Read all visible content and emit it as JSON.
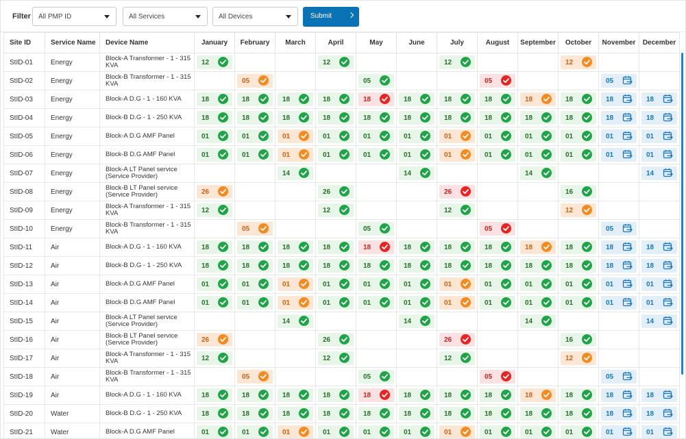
{
  "filter": {
    "label": "Filter",
    "pmp": "All PMP ID",
    "services": "All Services",
    "devices": "All Devices",
    "submit": "Submit"
  },
  "columns": {
    "site_id": "Site ID",
    "service": "Service Name",
    "device": "Device Name",
    "months": [
      "January",
      "February",
      "March",
      "April",
      "May",
      "June",
      "July",
      "August",
      "September",
      "October",
      "November",
      "December"
    ]
  },
  "status_icons": {
    "ok": "check-circle-icon",
    "warn": "check-circle-icon",
    "err": "check-circle-icon",
    "sched": "calendar-icon"
  },
  "colors": {
    "ok": "#21a34a",
    "warn": "#f28b22",
    "err": "#e52525",
    "sched": "#1b75bb",
    "accent": "#0a73b5"
  },
  "rows": [
    {
      "site": "StID-01",
      "service": "Energy",
      "device": "Block-A Transformer - 1 - 315 KVA",
      "cells": [
        {
          "v": "12",
          "s": "ok"
        },
        null,
        null,
        {
          "v": "12",
          "s": "ok"
        },
        null,
        null,
        {
          "v": "12",
          "s": "ok"
        },
        null,
        null,
        {
          "v": "12",
          "s": "warn"
        },
        null,
        null
      ]
    },
    {
      "site": "StID-02",
      "service": "Energy",
      "device": "Block-B Transformer - 1 - 315 KVA",
      "cells": [
        null,
        {
          "v": "05",
          "s": "warn"
        },
        null,
        null,
        {
          "v": "05",
          "s": "ok"
        },
        null,
        null,
        {
          "v": "05",
          "s": "err"
        },
        null,
        null,
        {
          "v": "05",
          "s": "sched"
        },
        null
      ]
    },
    {
      "site": "StID-03",
      "service": "Energy",
      "device": "Block-A D.G - 1 - 160 KVA",
      "cells": [
        {
          "v": "18",
          "s": "ok"
        },
        {
          "v": "18",
          "s": "ok"
        },
        {
          "v": "18",
          "s": "ok"
        },
        {
          "v": "18",
          "s": "ok"
        },
        {
          "v": "18",
          "s": "err"
        },
        {
          "v": "18",
          "s": "ok"
        },
        {
          "v": "18",
          "s": "ok"
        },
        {
          "v": "18",
          "s": "ok"
        },
        {
          "v": "18",
          "s": "warn"
        },
        {
          "v": "18",
          "s": "ok"
        },
        {
          "v": "18",
          "s": "sched"
        },
        {
          "v": "18",
          "s": "sched"
        }
      ]
    },
    {
      "site": "StID-04",
      "service": "Energy",
      "device": "Block-B D.G - 1 - 250 KVA",
      "cells": [
        {
          "v": "18",
          "s": "ok"
        },
        {
          "v": "18",
          "s": "ok"
        },
        {
          "v": "18",
          "s": "ok"
        },
        {
          "v": "18",
          "s": "ok"
        },
        {
          "v": "18",
          "s": "ok"
        },
        {
          "v": "18",
          "s": "ok"
        },
        {
          "v": "18",
          "s": "ok"
        },
        {
          "v": "18",
          "s": "ok"
        },
        {
          "v": "18",
          "s": "ok"
        },
        {
          "v": "18",
          "s": "ok"
        },
        {
          "v": "18",
          "s": "sched"
        },
        {
          "v": "18",
          "s": "sched"
        }
      ]
    },
    {
      "site": "StID-05",
      "service": "Energy",
      "device": "Block-A D.G AMF Panel",
      "cells": [
        {
          "v": "01",
          "s": "ok"
        },
        {
          "v": "01",
          "s": "ok"
        },
        {
          "v": "01",
          "s": "warn"
        },
        {
          "v": "01",
          "s": "ok"
        },
        {
          "v": "01",
          "s": "ok"
        },
        {
          "v": "01",
          "s": "ok"
        },
        {
          "v": "01",
          "s": "warn"
        },
        {
          "v": "01",
          "s": "ok"
        },
        {
          "v": "01",
          "s": "ok"
        },
        {
          "v": "01",
          "s": "ok"
        },
        {
          "v": "01",
          "s": "sched"
        },
        {
          "v": "01",
          "s": "sched"
        }
      ]
    },
    {
      "site": "StID-06",
      "service": "Energy",
      "device": "Block-B D.G AMF Panel",
      "cells": [
        {
          "v": "01",
          "s": "ok"
        },
        {
          "v": "01",
          "s": "ok"
        },
        {
          "v": "01",
          "s": "warn"
        },
        {
          "v": "01",
          "s": "ok"
        },
        {
          "v": "01",
          "s": "ok"
        },
        {
          "v": "01",
          "s": "ok"
        },
        {
          "v": "01",
          "s": "warn"
        },
        {
          "v": "01",
          "s": "ok"
        },
        {
          "v": "01",
          "s": "ok"
        },
        {
          "v": "01",
          "s": "ok"
        },
        {
          "v": "01",
          "s": "sched"
        },
        {
          "v": "01",
          "s": "sched"
        }
      ]
    },
    {
      "site": "StID-07",
      "service": "Energy",
      "device": "Block-A LT Panel service (Service Provider)",
      "cells": [
        null,
        null,
        {
          "v": "14",
          "s": "ok"
        },
        null,
        null,
        {
          "v": "14",
          "s": "ok"
        },
        null,
        null,
        {
          "v": "14",
          "s": "ok"
        },
        null,
        null,
        {
          "v": "14",
          "s": "sched"
        }
      ]
    },
    {
      "site": "StID-08",
      "service": "Energy",
      "device": "Block-B LT Panel service (Service Provider)",
      "cells": [
        {
          "v": "26",
          "s": "warn"
        },
        null,
        null,
        {
          "v": "26",
          "s": "ok"
        },
        null,
        null,
        {
          "v": "26",
          "s": "err"
        },
        null,
        null,
        {
          "v": "16",
          "s": "ok"
        },
        null,
        null
      ]
    },
    {
      "site": "StID-09",
      "service": "Energy",
      "device": "Block-A Transformer - 1 - 315 KVA",
      "cells": [
        {
          "v": "12",
          "s": "ok"
        },
        null,
        null,
        {
          "v": "12",
          "s": "ok"
        },
        null,
        null,
        {
          "v": "12",
          "s": "ok"
        },
        null,
        null,
        {
          "v": "12",
          "s": "warn"
        },
        null,
        null
      ]
    },
    {
      "site": "StID-10",
      "service": "Energy",
      "device": "Block-B Transformer - 1 - 315 KVA",
      "cells": [
        null,
        {
          "v": "05",
          "s": "warn"
        },
        null,
        null,
        {
          "v": "05",
          "s": "ok"
        },
        null,
        null,
        {
          "v": "05",
          "s": "err"
        },
        null,
        null,
        {
          "v": "05",
          "s": "sched"
        },
        null
      ]
    },
    {
      "site": "StID-11",
      "service": "Air",
      "device": "Block-A D.G - 1 - 160 KVA",
      "cells": [
        {
          "v": "18",
          "s": "ok"
        },
        {
          "v": "18",
          "s": "ok"
        },
        {
          "v": "18",
          "s": "ok"
        },
        {
          "v": "18",
          "s": "ok"
        },
        {
          "v": "18",
          "s": "err"
        },
        {
          "v": "18",
          "s": "ok"
        },
        {
          "v": "18",
          "s": "ok"
        },
        {
          "v": "18",
          "s": "ok"
        },
        {
          "v": "18",
          "s": "warn"
        },
        {
          "v": "18",
          "s": "ok"
        },
        {
          "v": "18",
          "s": "sched"
        },
        {
          "v": "18",
          "s": "sched"
        }
      ]
    },
    {
      "site": "StID-12",
      "service": "Air",
      "device": "Block-B D.G - 1 - 250 KVA",
      "cells": [
        {
          "v": "18",
          "s": "ok"
        },
        {
          "v": "18",
          "s": "ok"
        },
        {
          "v": "18",
          "s": "ok"
        },
        {
          "v": "18",
          "s": "ok"
        },
        {
          "v": "18",
          "s": "ok"
        },
        {
          "v": "18",
          "s": "ok"
        },
        {
          "v": "18",
          "s": "ok"
        },
        {
          "v": "18",
          "s": "ok"
        },
        {
          "v": "18",
          "s": "ok"
        },
        {
          "v": "18",
          "s": "ok"
        },
        {
          "v": "18",
          "s": "sched"
        },
        {
          "v": "18",
          "s": "sched"
        }
      ]
    },
    {
      "site": "StID-13",
      "service": "Air",
      "device": "Block-A D.G AMF Panel",
      "cells": [
        {
          "v": "01",
          "s": "ok"
        },
        {
          "v": "01",
          "s": "ok"
        },
        {
          "v": "01",
          "s": "warn"
        },
        {
          "v": "01",
          "s": "ok"
        },
        {
          "v": "01",
          "s": "ok"
        },
        {
          "v": "01",
          "s": "ok"
        },
        {
          "v": "01",
          "s": "warn"
        },
        {
          "v": "01",
          "s": "ok"
        },
        {
          "v": "01",
          "s": "ok"
        },
        {
          "v": "01",
          "s": "ok"
        },
        {
          "v": "01",
          "s": "sched"
        },
        {
          "v": "01",
          "s": "sched"
        }
      ]
    },
    {
      "site": "StID-14",
      "service": "Air",
      "device": "Block-B D.G AMF Panel",
      "cells": [
        {
          "v": "01",
          "s": "ok"
        },
        {
          "v": "01",
          "s": "ok"
        },
        {
          "v": "01",
          "s": "warn"
        },
        {
          "v": "01",
          "s": "ok"
        },
        {
          "v": "01",
          "s": "ok"
        },
        {
          "v": "01",
          "s": "ok"
        },
        {
          "v": "01",
          "s": "warn"
        },
        {
          "v": "01",
          "s": "ok"
        },
        {
          "v": "01",
          "s": "ok"
        },
        {
          "v": "01",
          "s": "ok"
        },
        {
          "v": "01",
          "s": "sched"
        },
        {
          "v": "01",
          "s": "sched"
        }
      ]
    },
    {
      "site": "StID-15",
      "service": "Air",
      "device": "Block-A LT Panel service (Service Provider)",
      "cells": [
        null,
        null,
        {
          "v": "14",
          "s": "ok"
        },
        null,
        null,
        {
          "v": "14",
          "s": "ok"
        },
        null,
        null,
        {
          "v": "14",
          "s": "ok"
        },
        null,
        null,
        {
          "v": "14",
          "s": "sched"
        }
      ]
    },
    {
      "site": "StID-16",
      "service": "Air",
      "device": "Block-B LT Panel service (Service Provider)",
      "cells": [
        {
          "v": "26",
          "s": "warn"
        },
        null,
        null,
        {
          "v": "26",
          "s": "ok"
        },
        null,
        null,
        {
          "v": "26",
          "s": "err"
        },
        null,
        null,
        {
          "v": "16",
          "s": "ok"
        },
        null,
        null
      ]
    },
    {
      "site": "StID-17",
      "service": "Air",
      "device": "Block-A Transformer - 1 - 315 KVA",
      "cells": [
        {
          "v": "12",
          "s": "ok"
        },
        null,
        null,
        {
          "v": "12",
          "s": "ok"
        },
        null,
        null,
        {
          "v": "12",
          "s": "ok"
        },
        null,
        null,
        {
          "v": "12",
          "s": "warn"
        },
        null,
        null
      ]
    },
    {
      "site": "StID-18",
      "service": "Air",
      "device": "Block-B Transformer - 1 - 315 KVA",
      "cells": [
        null,
        {
          "v": "05",
          "s": "warn"
        },
        null,
        null,
        {
          "v": "05",
          "s": "ok"
        },
        null,
        null,
        {
          "v": "05",
          "s": "err"
        },
        null,
        null,
        {
          "v": "05",
          "s": "sched"
        },
        null
      ]
    },
    {
      "site": "StID-19",
      "service": "Air",
      "device": "Block-A D.G - 1 - 160 KVA",
      "cells": [
        {
          "v": "18",
          "s": "ok"
        },
        {
          "v": "18",
          "s": "ok"
        },
        {
          "v": "18",
          "s": "ok"
        },
        {
          "v": "18",
          "s": "ok"
        },
        {
          "v": "18",
          "s": "err"
        },
        {
          "v": "18",
          "s": "ok"
        },
        {
          "v": "18",
          "s": "ok"
        },
        {
          "v": "18",
          "s": "ok"
        },
        {
          "v": "18",
          "s": "warn"
        },
        {
          "v": "18",
          "s": "ok"
        },
        {
          "v": "18",
          "s": "sched"
        },
        {
          "v": "18",
          "s": "sched"
        }
      ]
    },
    {
      "site": "StID-20",
      "service": "Water",
      "device": "Block-B D.G - 1 - 250 KVA",
      "cells": [
        {
          "v": "18",
          "s": "ok"
        },
        {
          "v": "18",
          "s": "ok"
        },
        {
          "v": "18",
          "s": "ok"
        },
        {
          "v": "18",
          "s": "ok"
        },
        {
          "v": "18",
          "s": "ok"
        },
        {
          "v": "18",
          "s": "ok"
        },
        {
          "v": "18",
          "s": "ok"
        },
        {
          "v": "18",
          "s": "ok"
        },
        {
          "v": "18",
          "s": "ok"
        },
        {
          "v": "18",
          "s": "ok"
        },
        {
          "v": "18",
          "s": "sched"
        },
        {
          "v": "18",
          "s": "sched"
        }
      ]
    },
    {
      "site": "StID-21",
      "service": "Water",
      "device": "Block-A D.G AMF Panel",
      "cells": [
        {
          "v": "01",
          "s": "ok"
        },
        {
          "v": "01",
          "s": "ok"
        },
        {
          "v": "01",
          "s": "warn"
        },
        {
          "v": "01",
          "s": "ok"
        },
        {
          "v": "01",
          "s": "ok"
        },
        {
          "v": "01",
          "s": "ok"
        },
        {
          "v": "01",
          "s": "warn"
        },
        {
          "v": "01",
          "s": "ok"
        },
        {
          "v": "01",
          "s": "ok"
        },
        {
          "v": "01",
          "s": "ok"
        },
        {
          "v": "01",
          "s": "sched"
        },
        {
          "v": "01",
          "s": "sched"
        }
      ]
    }
  ]
}
